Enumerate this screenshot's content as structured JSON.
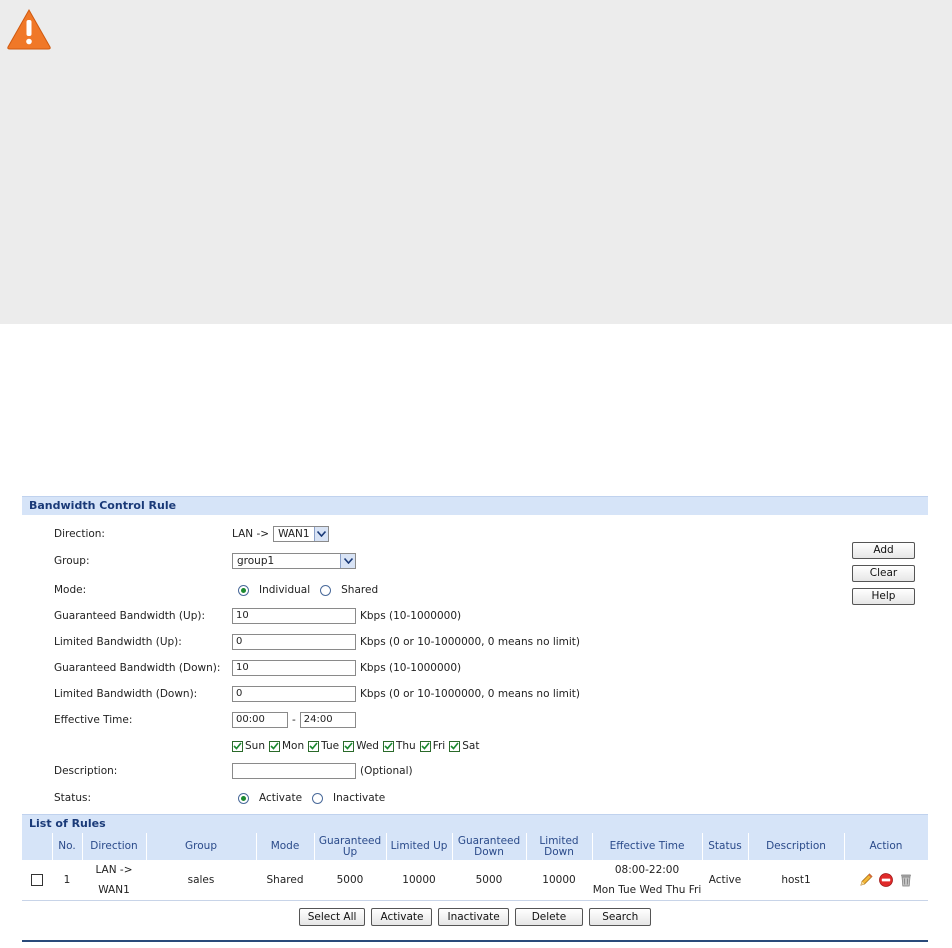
{
  "rule_section": {
    "title": "Bandwidth Control Rule",
    "direction": {
      "label": "Direction:",
      "prefix": "LAN ->",
      "value": "WAN1"
    },
    "group": {
      "label": "Group:",
      "value": "group1"
    },
    "mode": {
      "label": "Mode:",
      "options": [
        "Individual",
        "Shared"
      ],
      "selected": "Individual"
    },
    "guaranteed_up": {
      "label": "Guaranteed Bandwidth (Up):",
      "value": "10",
      "hint": "Kbps (10-1000000)"
    },
    "limited_up": {
      "label": "Limited Bandwidth (Up):",
      "value": "0",
      "hint": "Kbps (0 or 10-1000000, 0 means no limit)"
    },
    "guaranteed_down": {
      "label": "Guaranteed Bandwidth (Down):",
      "value": "10",
      "hint": "Kbps (10-1000000)"
    },
    "limited_down": {
      "label": "Limited Bandwidth (Down):",
      "value": "0",
      "hint": "Kbps (0 or 10-1000000, 0 means no limit)"
    },
    "effective_time": {
      "label": "Effective Time:",
      "start": "00:00",
      "separator": "-",
      "end": "24:00"
    },
    "days": [
      "Sun",
      "Mon",
      "Tue",
      "Wed",
      "Thu",
      "Fri",
      "Sat"
    ],
    "description": {
      "label": "Description:",
      "value": "",
      "hint": "(Optional)"
    },
    "status": {
      "label": "Status:",
      "options": [
        "Activate",
        "Inactivate"
      ],
      "selected": "Activate"
    },
    "buttons": {
      "add": "Add",
      "clear": "Clear",
      "help": "Help"
    }
  },
  "list_section": {
    "title": "List of Rules",
    "columns": [
      "No.",
      "Direction",
      "Group",
      "Mode",
      "Guaranteed Up",
      "Limited Up",
      "Guaranteed Down",
      "Limited Down",
      "Effective Time",
      "Status",
      "Description",
      "Action"
    ],
    "rows": [
      {
        "no": "1",
        "direction_line1": "LAN ->",
        "direction_line2": "WAN1",
        "group": "sales",
        "mode": "Shared",
        "guaranteed_up": "5000",
        "limited_up": "10000",
        "guaranteed_down": "5000",
        "limited_down": "10000",
        "time_line1": "08:00-22:00",
        "time_line2": "Mon Tue Wed Thu Fri",
        "status": "Active",
        "description": "host1"
      }
    ],
    "buttons": {
      "select_all": "Select All",
      "activate": "Activate",
      "inactivate": "Inactivate",
      "delete": "Delete",
      "search": "Search"
    }
  },
  "icons": {
    "note": "warning-icon",
    "edit": "pencil-icon",
    "disable": "stop-icon",
    "delete": "trash-icon"
  },
  "colors": {
    "header_bg": "#d6e4f8",
    "header_text": "#1a3a78",
    "warning": "#f07828"
  }
}
